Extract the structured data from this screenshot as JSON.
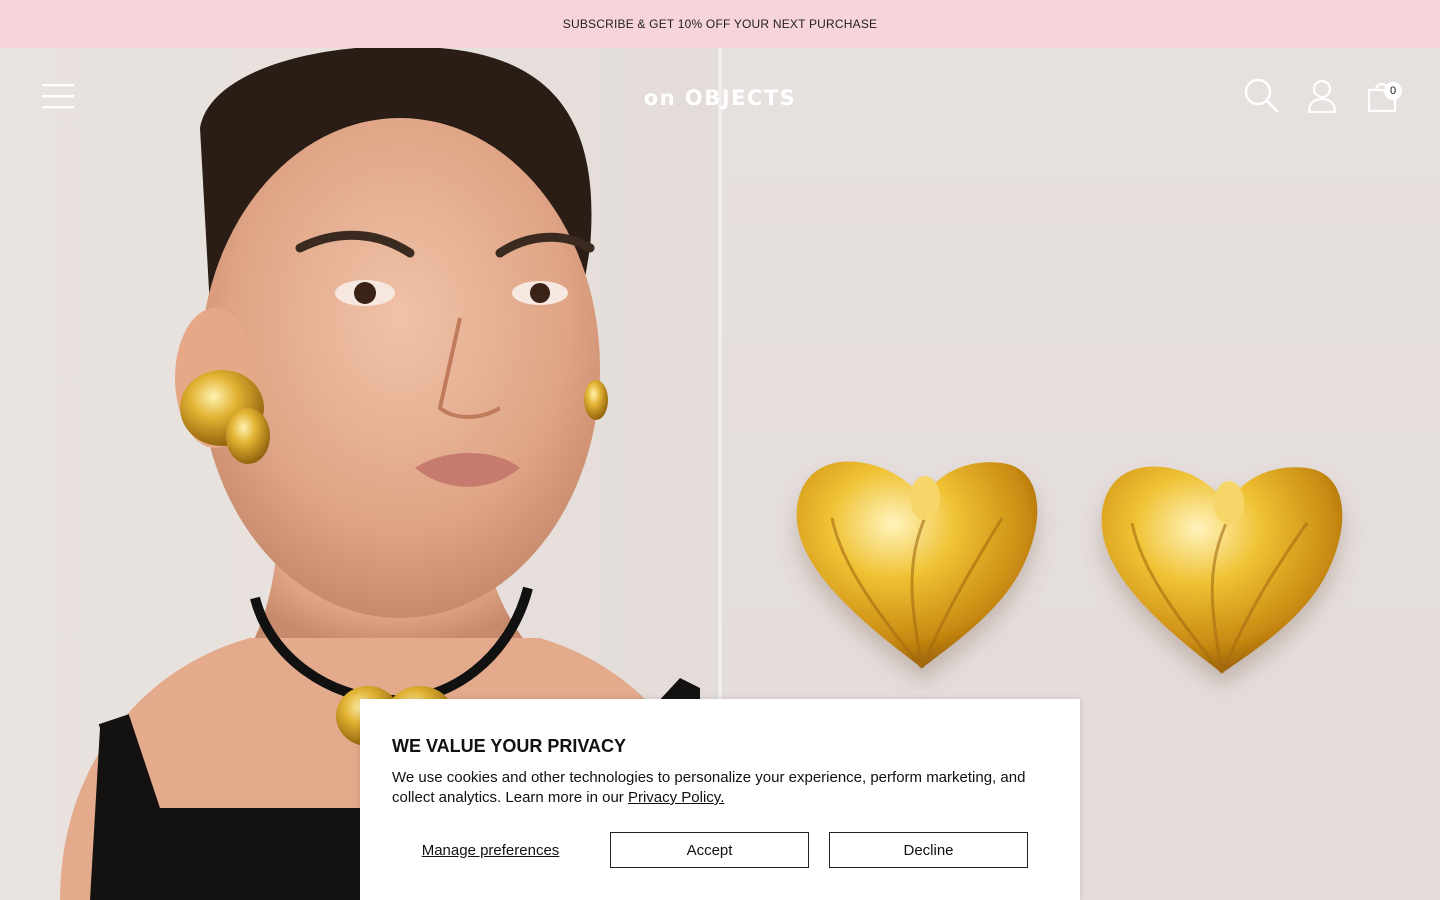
{
  "promo": {
    "text": "SUBSCRIBE & GET 10% OFF YOUR NEXT PURCHASE"
  },
  "header": {
    "logo": "on OBJECTS",
    "cart_count": "0"
  },
  "icons": {
    "menu": "hamburger-menu-icon",
    "search": "search-icon",
    "account": "user-icon",
    "cart": "shopping-bag-icon"
  },
  "cookie": {
    "title": "WE VALUE YOUR PRIVACY",
    "body": "We use cookies and other technologies to personalize your experience, perform marketing, and collect analytics. Learn more in our ",
    "policy_link": "Privacy Policy.",
    "manage_label": "Manage preferences",
    "accept_label": "Accept",
    "decline_label": "Decline"
  },
  "colors": {
    "promo_bg": "#f7d3dc",
    "hero_bg": "#e6e0dd",
    "gold": "#d9a520"
  }
}
